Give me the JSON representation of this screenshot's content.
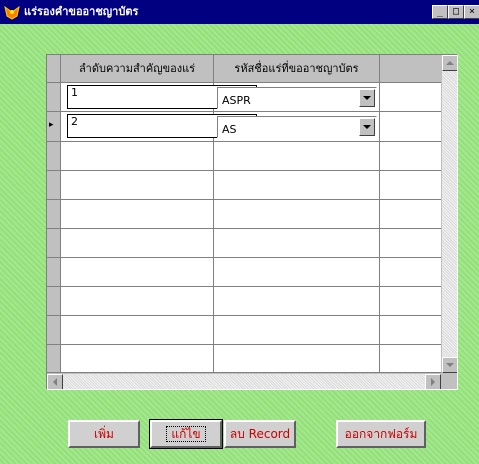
{
  "window": {
    "title": "แร่รองคำขออาชญาบัตร",
    "minimize_glyph": "_",
    "maximize_glyph": "□",
    "close_glyph": "×"
  },
  "grid": {
    "columns": [
      "ลำดับความสำคัญของแร่",
      "รหัสชื่อแร่ที่ขออาชญาบัตร"
    ],
    "rows": [
      {
        "priority": "1",
        "mineral_code": "ASPR"
      },
      {
        "priority": "2",
        "mineral_code": "AS"
      }
    ],
    "current_row_marker": "▸"
  },
  "buttons": {
    "add": "เพิ่ม",
    "edit": "แก้ไข",
    "delete": "ลบ Record",
    "exit": "ออกจากฟอร์ม"
  },
  "colors": {
    "background": "#99e680",
    "titlebar": "#000080",
    "button_text": "#cc0000"
  }
}
